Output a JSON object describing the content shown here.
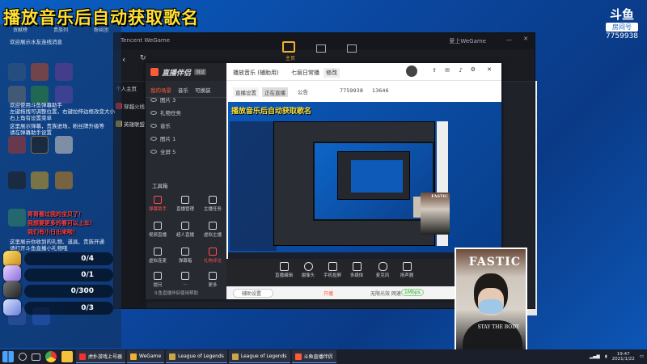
{
  "banner": {
    "title": "播放音乐后自动获取歌名"
  },
  "douyu": {
    "mark": "斗鱼",
    "sub": "房间号",
    "room": "7759938"
  },
  "overlay": {
    "tabs": [
      "贡献榜",
      "贵族列",
      "粉丝团"
    ],
    "lines": [
      "欢迎展示水友连线消息",
      "欢迎使用斗鱼弹幕助手",
      "左键拖拽可调整位置，右键拉伸边框改变大小",
      "右上角有设置菜单",
      "这里展示弹幕，贵族进场，粉丝牌升级等",
      "请在弹幕助手设置",
      "这里展示你收到的礼物、道具、贵族开通",
      "请打开斗鱼直播小礼物哦"
    ],
    "red": [
      "哥哥看过我的宝贝了！",
      "我想要更多的看可以上车！",
      "我们有小日出来啦！"
    ],
    "gifts": [
      {
        "name": "gift-treasure",
        "value": "0/4"
      },
      {
        "name": "gift-crystal",
        "value": "0/1"
      },
      {
        "name": "gift-rocket",
        "value": "0/300"
      },
      {
        "name": "gift-plane",
        "value": "0/3"
      }
    ]
  },
  "wegame": {
    "title": "Tencent WeGame",
    "nav_home": "主页",
    "side": [
      "个人主页",
      "穿越火线",
      "英雄联盟"
    ],
    "user": "爱上WeGame"
  },
  "zbbl": {
    "app_name": "直播伴侣",
    "badge": "测试",
    "left_tabs": [
      "我的场景",
      "音乐",
      "可换装"
    ],
    "scenes": [
      "图片 3",
      "礼物任务",
      "音乐",
      "图片 1",
      "全屏 5"
    ],
    "tools_title": "工具箱",
    "tools": [
      "弹幕助手",
      "直播管理",
      "主播任务",
      "视频直播",
      "超人直播",
      "虚拟主播",
      "虚拟连麦",
      "弹幕箱",
      "礼物评论",
      "提问",
      "...",
      "更多"
    ],
    "bottom_link": "斗鱼直播伴侣使用帮助",
    "settings_label": "辅助设置",
    "room_title": "播放音乐 (辅助用)",
    "room_sub": "七层日常播",
    "room_edit": "修改",
    "room_id_label": "直播设置",
    "room_status": "正在直播",
    "fans_label": "公告",
    "room_num": "7759938",
    "viewers": "13646",
    "controls": [
      "直播编辑",
      "摄像头",
      "手机投屏",
      "多媒体",
      "麦克风",
      "扬声器"
    ],
    "bottom_tag": "开播",
    "bottom_status": "无限光效 网速",
    "bitrate": "1Mbps",
    "fps": "60"
  },
  "taskbar": {
    "items": [
      "虎扑游戏上号器",
      "WeGame",
      "League of Legends",
      "League of Legends",
      "斗鱼直播伴侣"
    ],
    "time": "19:47",
    "date": "2021/1/22"
  },
  "cam": {
    "headline": "FASTIC",
    "sub": "STAY THE BODY"
  },
  "colors": {
    "banner": "#ffe033",
    "accent": "#ff5a36",
    "desktop": "#0b4ea0"
  }
}
